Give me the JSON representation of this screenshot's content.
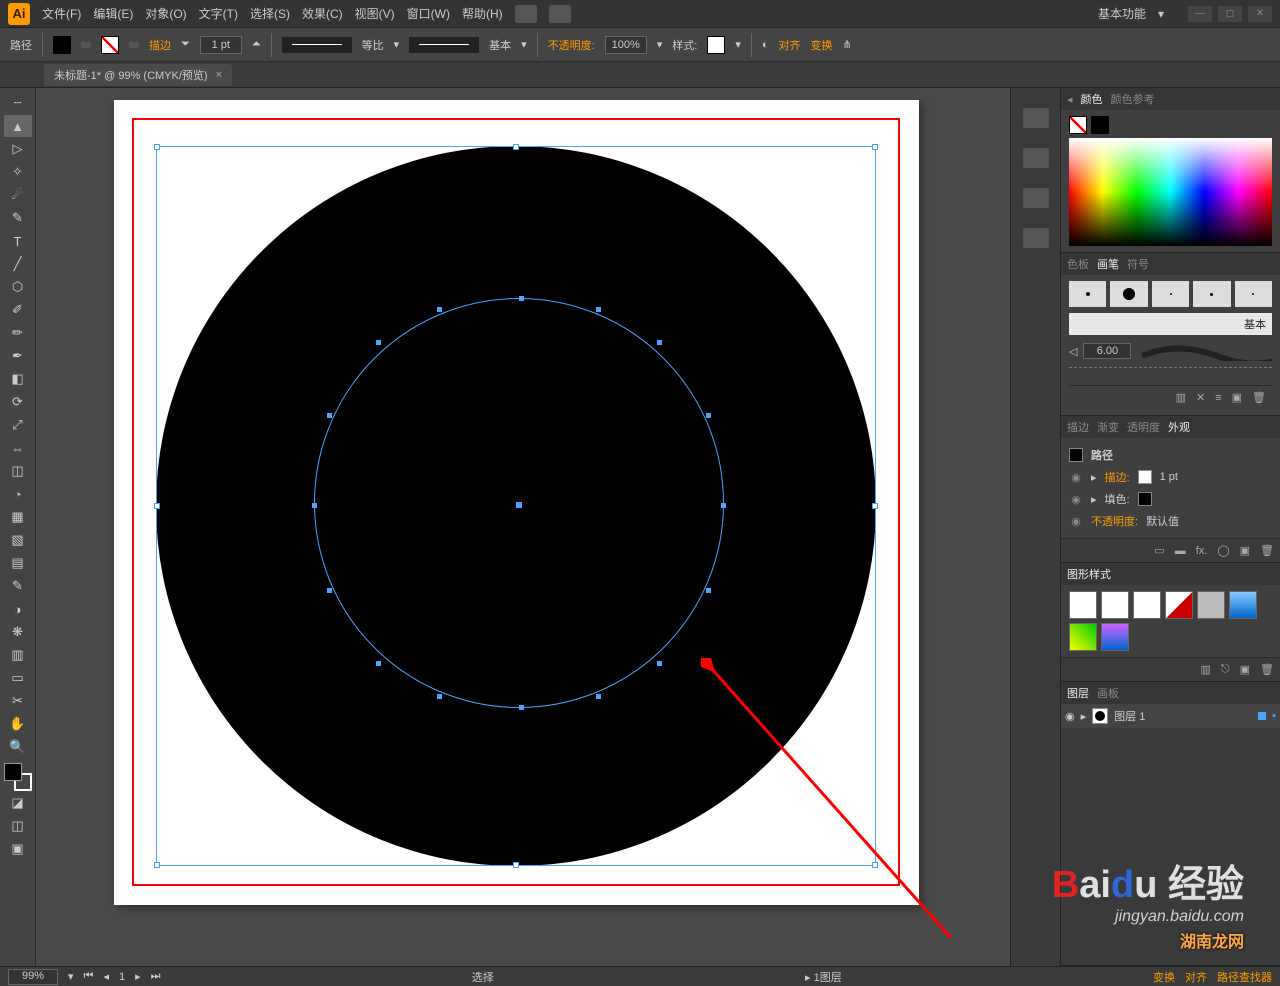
{
  "app_logo": "Ai",
  "menubar": {
    "items": [
      "文件(F)",
      "编辑(E)",
      "对象(O)",
      "文字(T)",
      "选择(S)",
      "效果(C)",
      "视图(V)",
      "窗口(W)",
      "帮助(H)"
    ],
    "workspace": "基本功能"
  },
  "optbar": {
    "label": "路径",
    "stroke_label": "描边",
    "stroke_weight": "1 pt",
    "profile_label": "等比",
    "brush_label": "基本",
    "opacity_label": "不透明度:",
    "opacity_value": "100%",
    "style_label": "样式:",
    "align_label": "对齐",
    "transform_label": "变换"
  },
  "document": {
    "tab_title": "未标题-1* @ 99% (CMYK/预览)"
  },
  "panels": {
    "color": {
      "tabs": [
        "颜色",
        "颜色参考"
      ],
      "active": 0
    },
    "brushes": {
      "tabs": [
        "色板",
        "画笔",
        "符号"
      ],
      "active": 1,
      "label_basic": "基本",
      "size": "6.00"
    },
    "appearance": {
      "tabs": [
        "描边",
        "渐变",
        "透明度",
        "外观"
      ],
      "active": 3,
      "object_label": "路径",
      "rows": [
        {
          "label": "描边:",
          "value": "1 pt",
          "orange": true
        },
        {
          "label": "填色:",
          "value": "",
          "orange": false
        },
        {
          "label": "不透明度:",
          "value": "默认值",
          "orange": true
        }
      ],
      "fx_label": "fx."
    },
    "styles": {
      "tabs": [
        "图形样式"
      ],
      "active": 0
    },
    "layers": {
      "tabs": [
        "图层",
        "画板"
      ],
      "active": 0,
      "layer_name": "图层 1",
      "footer": [
        "变换",
        "对齐",
        "路径查找器"
      ]
    }
  },
  "statusbar": {
    "zoom": "99%",
    "tool": "选择",
    "nav": "▸ 1图层"
  },
  "watermark": {
    "brand_html": "Baidu 经验",
    "url": "jingyan.baidu.com",
    "site": "湖南龙网"
  }
}
